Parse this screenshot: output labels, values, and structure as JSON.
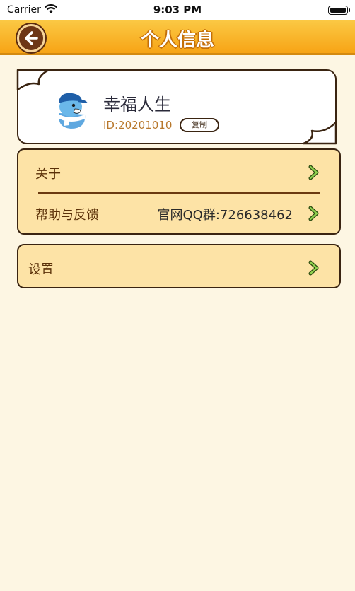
{
  "status_bar": {
    "carrier": "Carrier",
    "time": "9:03 PM"
  },
  "header": {
    "title": "个人信息",
    "back_icon": "arrow-left-icon"
  },
  "profile": {
    "name": "幸福人生",
    "id_text": "ID:20201010",
    "copy_label": "复制",
    "avatar_icon": "avatar-bird-icon"
  },
  "menu_group_1": {
    "items": [
      {
        "label": "关于",
        "value": ""
      },
      {
        "label": "帮助与反馈",
        "value": "官网QQ群:726638462"
      }
    ]
  },
  "menu_group_2": {
    "items": [
      {
        "label": "设置",
        "value": ""
      }
    ]
  },
  "colors": {
    "background": "#fdf6e3",
    "header_accent": "#f7a416",
    "card_fill": "#fde3a6",
    "border": "#3a2411",
    "chevron": "#7ac143"
  }
}
